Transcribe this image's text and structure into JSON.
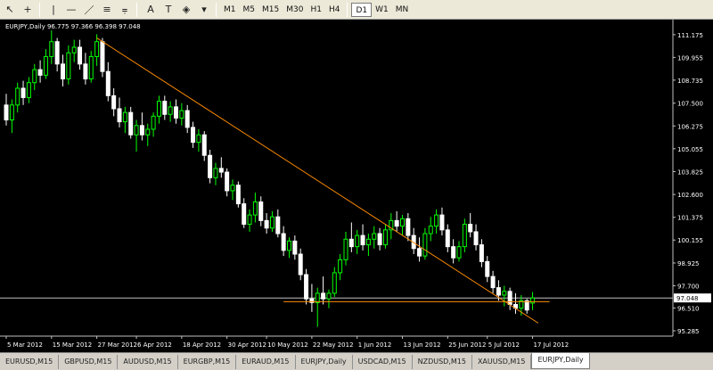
{
  "toolbar": {
    "tools": [
      {
        "name": "cursor-icon",
        "glyph": "↖"
      },
      {
        "name": "crosshair-icon",
        "glyph": "+"
      },
      {
        "name": "vertical-line-icon",
        "glyph": "|"
      },
      {
        "name": "horizontal-line-icon",
        "glyph": "—"
      },
      {
        "name": "trendline-icon",
        "glyph": "／"
      },
      {
        "name": "equidistant-channel-icon",
        "glyph": "≡"
      },
      {
        "name": "fibonacci-icon",
        "glyph": "⩦"
      },
      {
        "name": "text-tool-icon",
        "glyph": "A"
      },
      {
        "name": "text-label-icon",
        "glyph": "T"
      },
      {
        "name": "shapes-icon",
        "glyph": "◈"
      }
    ],
    "timeframes": [
      "M1",
      "M5",
      "M15",
      "M30",
      "H1",
      "H4",
      "D1",
      "W1",
      "MN"
    ],
    "active_timeframe": "D1"
  },
  "chart": {
    "title": "EURJPY,Daily  96.775 97.366 96.398 97.048",
    "current_price": "97.048"
  },
  "tabs": [
    "EURUSD,M15",
    "GBPUSD,M15",
    "AUDUSD,M15",
    "EURGBP,M15",
    "EURAUD,M15",
    "EURJPY,Daily",
    "USDCAD,M15",
    "NZDUSD,M15",
    "XAUUSD,M15",
    "EURJPY,Daily"
  ],
  "active_tab_index": 9,
  "colors": {
    "background": "#000000",
    "bull_candle": "#00ff00",
    "bear_candle": "#ffffff",
    "trendline": "#ff8c00",
    "support_line": "#ff8c00",
    "price_line": "#c0c0c0",
    "axis_text": "#ffffff"
  },
  "chart_data": {
    "type": "candlestick",
    "symbol": "EURJPY",
    "timeframe": "Daily",
    "ylim": [
      95.0,
      111.6
    ],
    "yticks": [
      "111.175",
      "109.955",
      "108.735",
      "107.500",
      "106.275",
      "105.055",
      "103.825",
      "102.600",
      "101.375",
      "100.155",
      "98.925",
      "97.700",
      "96.510",
      "95.285"
    ],
    "ytick_values": [
      111.175,
      109.955,
      108.735,
      107.5,
      106.275,
      105.055,
      103.825,
      102.6,
      101.375,
      100.155,
      98.925,
      97.7,
      96.51,
      95.285
    ],
    "xticks": [
      "5 Mar 2012",
      "15 Mar 2012",
      "27 Mar 2012",
      "6 Apr 2012",
      "18 Apr 2012",
      "30 Apr 2012",
      "10 May 2012",
      "22 May 2012",
      "1 Jun 2012",
      "13 Jun 2012",
      "25 Jun 2012",
      "5 Jul 2012",
      "17 Jul 2012"
    ],
    "xtick_bar_index": [
      0,
      8,
      16,
      23,
      31,
      39,
      46,
      54,
      62,
      70,
      78,
      85,
      93
    ],
    "candles": [
      {
        "o": 107.4,
        "h": 108.0,
        "l": 106.3,
        "c": 106.6
      },
      {
        "o": 106.6,
        "h": 107.7,
        "l": 105.9,
        "c": 107.4
      },
      {
        "o": 107.4,
        "h": 108.6,
        "l": 107.0,
        "c": 108.3
      },
      {
        "o": 108.3,
        "h": 108.7,
        "l": 107.4,
        "c": 107.8
      },
      {
        "o": 107.8,
        "h": 108.9,
        "l": 107.5,
        "c": 108.6
      },
      {
        "o": 108.6,
        "h": 109.6,
        "l": 108.2,
        "c": 109.3
      },
      {
        "o": 109.3,
        "h": 109.8,
        "l": 108.6,
        "c": 109.0
      },
      {
        "o": 109.0,
        "h": 110.4,
        "l": 108.8,
        "c": 110.0
      },
      {
        "o": 110.0,
        "h": 111.4,
        "l": 109.6,
        "c": 110.8
      },
      {
        "o": 110.8,
        "h": 111.0,
        "l": 109.2,
        "c": 109.6
      },
      {
        "o": 109.6,
        "h": 110.1,
        "l": 108.4,
        "c": 108.8
      },
      {
        "o": 108.8,
        "h": 110.6,
        "l": 108.5,
        "c": 110.2
      },
      {
        "o": 110.2,
        "h": 110.9,
        "l": 109.7,
        "c": 110.5
      },
      {
        "o": 110.5,
        "h": 110.9,
        "l": 109.3,
        "c": 109.6
      },
      {
        "o": 109.6,
        "h": 110.2,
        "l": 108.5,
        "c": 108.8
      },
      {
        "o": 108.8,
        "h": 110.3,
        "l": 108.6,
        "c": 110.0
      },
      {
        "o": 110.0,
        "h": 111.2,
        "l": 109.5,
        "c": 110.8
      },
      {
        "o": 110.8,
        "h": 111.0,
        "l": 108.9,
        "c": 109.2
      },
      {
        "o": 109.2,
        "h": 109.7,
        "l": 107.6,
        "c": 107.9
      },
      {
        "o": 107.9,
        "h": 108.3,
        "l": 106.8,
        "c": 107.2
      },
      {
        "o": 107.2,
        "h": 107.8,
        "l": 106.2,
        "c": 106.5
      },
      {
        "o": 106.5,
        "h": 107.3,
        "l": 105.9,
        "c": 107.0
      },
      {
        "o": 107.0,
        "h": 107.3,
        "l": 105.6,
        "c": 105.8
      },
      {
        "o": 105.8,
        "h": 106.6,
        "l": 104.9,
        "c": 106.3
      },
      {
        "o": 106.3,
        "h": 107.0,
        "l": 105.5,
        "c": 105.8
      },
      {
        "o": 105.8,
        "h": 106.4,
        "l": 105.2,
        "c": 106.1
      },
      {
        "o": 106.1,
        "h": 107.0,
        "l": 105.7,
        "c": 106.8
      },
      {
        "o": 106.8,
        "h": 107.9,
        "l": 106.4,
        "c": 107.6
      },
      {
        "o": 107.6,
        "h": 107.9,
        "l": 106.6,
        "c": 106.9
      },
      {
        "o": 106.9,
        "h": 107.6,
        "l": 106.5,
        "c": 107.3
      },
      {
        "o": 107.3,
        "h": 107.7,
        "l": 106.4,
        "c": 106.7
      },
      {
        "o": 106.7,
        "h": 107.5,
        "l": 106.3,
        "c": 107.1
      },
      {
        "o": 107.1,
        "h": 107.4,
        "l": 105.9,
        "c": 106.2
      },
      {
        "o": 106.2,
        "h": 106.5,
        "l": 105.1,
        "c": 105.4
      },
      {
        "o": 105.4,
        "h": 106.1,
        "l": 104.9,
        "c": 105.8
      },
      {
        "o": 105.8,
        "h": 106.0,
        "l": 104.4,
        "c": 104.7
      },
      {
        "o": 104.7,
        "h": 105.0,
        "l": 103.2,
        "c": 103.5
      },
      {
        "o": 103.5,
        "h": 104.3,
        "l": 103.1,
        "c": 104.0
      },
      {
        "o": 104.0,
        "h": 104.6,
        "l": 103.5,
        "c": 103.8
      },
      {
        "o": 103.8,
        "h": 104.0,
        "l": 102.5,
        "c": 102.8
      },
      {
        "o": 102.8,
        "h": 103.4,
        "l": 102.3,
        "c": 103.1
      },
      {
        "o": 103.1,
        "h": 103.3,
        "l": 101.9,
        "c": 102.1
      },
      {
        "o": 102.1,
        "h": 102.4,
        "l": 100.8,
        "c": 101.0
      },
      {
        "o": 101.0,
        "h": 101.8,
        "l": 100.6,
        "c": 101.5
      },
      {
        "o": 101.5,
        "h": 102.7,
        "l": 101.1,
        "c": 102.2
      },
      {
        "o": 102.2,
        "h": 102.5,
        "l": 100.9,
        "c": 101.2
      },
      {
        "o": 101.2,
        "h": 101.6,
        "l": 100.5,
        "c": 100.8
      },
      {
        "o": 100.8,
        "h": 101.7,
        "l": 100.6,
        "c": 101.4
      },
      {
        "o": 101.4,
        "h": 101.8,
        "l": 100.3,
        "c": 100.5
      },
      {
        "o": 100.5,
        "h": 100.9,
        "l": 99.3,
        "c": 99.6
      },
      {
        "o": 99.6,
        "h": 100.3,
        "l": 99.2,
        "c": 100.1
      },
      {
        "o": 100.1,
        "h": 100.4,
        "l": 99.1,
        "c": 99.4
      },
      {
        "o": 99.4,
        "h": 99.7,
        "l": 98.0,
        "c": 98.3
      },
      {
        "o": 98.3,
        "h": 98.6,
        "l": 96.7,
        "c": 97.0
      },
      {
        "o": 97.0,
        "h": 97.8,
        "l": 96.3,
        "c": 96.8
      },
      {
        "o": 96.8,
        "h": 97.6,
        "l": 95.5,
        "c": 97.3
      },
      {
        "o": 97.3,
        "h": 98.2,
        "l": 96.7,
        "c": 97.0
      },
      {
        "o": 97.0,
        "h": 97.5,
        "l": 96.5,
        "c": 97.3
      },
      {
        "o": 97.3,
        "h": 98.7,
        "l": 97.1,
        "c": 98.4
      },
      {
        "o": 98.4,
        "h": 99.4,
        "l": 98.0,
        "c": 99.1
      },
      {
        "o": 99.1,
        "h": 100.6,
        "l": 98.8,
        "c": 100.2
      },
      {
        "o": 100.2,
        "h": 101.1,
        "l": 99.5,
        "c": 99.8
      },
      {
        "o": 99.8,
        "h": 100.7,
        "l": 99.4,
        "c": 100.4
      },
      {
        "o": 100.4,
        "h": 101.0,
        "l": 99.6,
        "c": 99.9
      },
      {
        "o": 99.9,
        "h": 100.5,
        "l": 99.3,
        "c": 100.2
      },
      {
        "o": 100.2,
        "h": 100.9,
        "l": 99.7,
        "c": 100.5
      },
      {
        "o": 100.5,
        "h": 100.8,
        "l": 99.6,
        "c": 99.9
      },
      {
        "o": 99.9,
        "h": 101.0,
        "l": 99.7,
        "c": 100.7
      },
      {
        "o": 100.7,
        "h": 101.6,
        "l": 100.2,
        "c": 101.2
      },
      {
        "o": 101.2,
        "h": 101.7,
        "l": 100.6,
        "c": 100.9
      },
      {
        "o": 100.9,
        "h": 101.5,
        "l": 100.4,
        "c": 101.3
      },
      {
        "o": 101.3,
        "h": 101.6,
        "l": 100.1,
        "c": 100.4
      },
      {
        "o": 100.4,
        "h": 100.8,
        "l": 99.4,
        "c": 99.7
      },
      {
        "o": 99.7,
        "h": 100.3,
        "l": 99.0,
        "c": 99.3
      },
      {
        "o": 99.3,
        "h": 100.8,
        "l": 99.1,
        "c": 100.5
      },
      {
        "o": 100.5,
        "h": 101.4,
        "l": 100.1,
        "c": 100.9
      },
      {
        "o": 100.9,
        "h": 101.8,
        "l": 100.5,
        "c": 101.5
      },
      {
        "o": 101.5,
        "h": 101.9,
        "l": 100.4,
        "c": 100.7
      },
      {
        "o": 100.7,
        "h": 101.0,
        "l": 99.5,
        "c": 99.8
      },
      {
        "o": 99.8,
        "h": 100.2,
        "l": 98.9,
        "c": 99.2
      },
      {
        "o": 99.2,
        "h": 100.1,
        "l": 99.0,
        "c": 99.8
      },
      {
        "o": 99.8,
        "h": 101.3,
        "l": 99.5,
        "c": 101.0
      },
      {
        "o": 101.0,
        "h": 101.6,
        "l": 100.3,
        "c": 100.6
      },
      {
        "o": 100.6,
        "h": 101.0,
        "l": 99.6,
        "c": 99.9
      },
      {
        "o": 99.9,
        "h": 100.2,
        "l": 98.7,
        "c": 99.0
      },
      {
        "o": 99.0,
        "h": 99.3,
        "l": 97.9,
        "c": 98.2
      },
      {
        "o": 98.2,
        "h": 98.5,
        "l": 97.3,
        "c": 97.6
      },
      {
        "o": 97.6,
        "h": 98.0,
        "l": 96.9,
        "c": 97.2
      },
      {
        "o": 97.2,
        "h": 97.7,
        "l": 96.6,
        "c": 97.4
      },
      {
        "o": 97.4,
        "h": 97.6,
        "l": 96.4,
        "c": 96.7
      },
      {
        "o": 96.7,
        "h": 97.3,
        "l": 96.2,
        "c": 96.5
      },
      {
        "o": 96.5,
        "h": 97.2,
        "l": 96.1,
        "c": 96.9
      },
      {
        "o": 96.9,
        "h": 97.0,
        "l": 96.2,
        "c": 96.4
      },
      {
        "o": 96.775,
        "h": 97.366,
        "l": 96.398,
        "c": 97.048
      }
    ],
    "trendline": {
      "from_bar": 16,
      "from_price": 111.0,
      "to_bar": 94,
      "to_price": 95.7
    },
    "support_line": {
      "from_bar": 49,
      "to_bar": 96,
      "price": 96.85
    },
    "price_line": 97.048
  }
}
